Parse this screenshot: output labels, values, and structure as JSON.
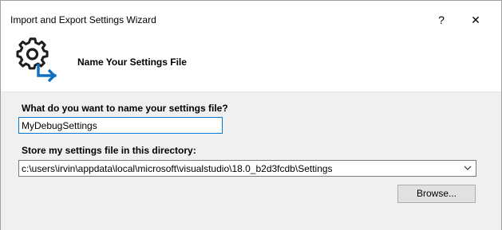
{
  "window": {
    "title": "Import and Export Settings Wizard",
    "help_label": "?",
    "close_label": "✕"
  },
  "header": {
    "title": "Name Your Settings File",
    "icon": "gear-arrow-icon"
  },
  "form": {
    "name_label": "What do you want to name your settings file?",
    "name_value": "MyDebugSettings",
    "dir_label": "Store my settings file in this directory:",
    "dir_value": "c:\\users\\irvin\\appdata\\local\\microsoft\\visualstudio\\18.0_b2d3fcdb\\Settings",
    "browse_label": "Browse..."
  },
  "colors": {
    "accent": "#0078d7",
    "panel": "#f0f0f0"
  }
}
